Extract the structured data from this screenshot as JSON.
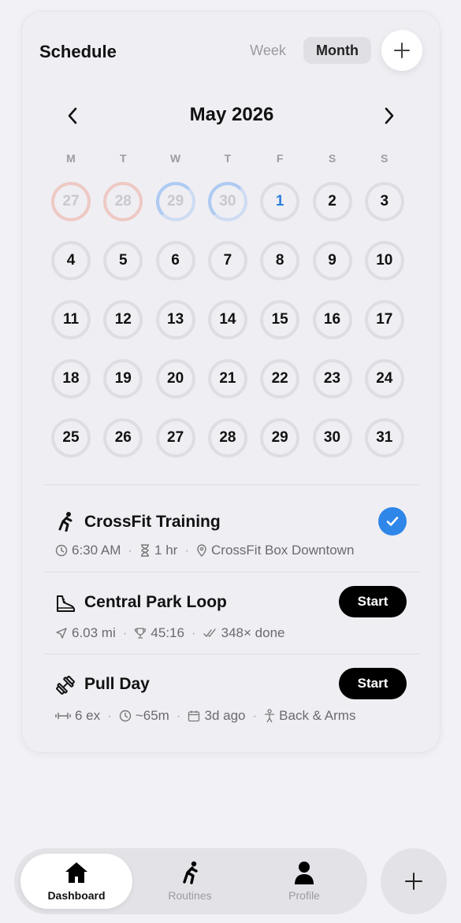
{
  "header": {
    "title": "Schedule",
    "week_label": "Week",
    "month_label": "Month"
  },
  "calendar": {
    "month_label": "May 2026",
    "weekdays": [
      "M",
      "T",
      "W",
      "T",
      "F",
      "S",
      "S"
    ],
    "days": [
      {
        "label": "27",
        "status": "missed"
      },
      {
        "label": "28",
        "status": "missed"
      },
      {
        "label": "29",
        "status": "in-progress"
      },
      {
        "label": "30",
        "status": "in-progress"
      },
      {
        "label": "1",
        "status": "today"
      },
      {
        "label": "2",
        "status": "normal"
      },
      {
        "label": "3",
        "status": "normal"
      },
      {
        "label": "4",
        "status": "normal"
      },
      {
        "label": "5",
        "status": "normal"
      },
      {
        "label": "6",
        "status": "normal"
      },
      {
        "label": "7",
        "status": "normal"
      },
      {
        "label": "8",
        "status": "normal"
      },
      {
        "label": "9",
        "status": "normal"
      },
      {
        "label": "10",
        "status": "normal"
      },
      {
        "label": "11",
        "status": "normal"
      },
      {
        "label": "12",
        "status": "normal"
      },
      {
        "label": "13",
        "status": "normal"
      },
      {
        "label": "14",
        "status": "normal"
      },
      {
        "label": "15",
        "status": "normal"
      },
      {
        "label": "16",
        "status": "normal"
      },
      {
        "label": "17",
        "status": "normal"
      },
      {
        "label": "18",
        "status": "normal"
      },
      {
        "label": "19",
        "status": "normal"
      },
      {
        "label": "20",
        "status": "normal"
      },
      {
        "label": "21",
        "status": "normal"
      },
      {
        "label": "22",
        "status": "normal"
      },
      {
        "label": "23",
        "status": "normal"
      },
      {
        "label": "24",
        "status": "normal"
      },
      {
        "label": "25",
        "status": "normal"
      },
      {
        "label": "26",
        "status": "normal"
      },
      {
        "label": "27",
        "status": "normal"
      },
      {
        "label": "28",
        "status": "normal"
      },
      {
        "label": "29",
        "status": "normal"
      },
      {
        "label": "30",
        "status": "normal"
      },
      {
        "label": "31",
        "status": "normal"
      }
    ]
  },
  "items": [
    {
      "title": "CrossFit Training",
      "icon": "stretch-figure-icon",
      "status": "completed",
      "time": "6:30 AM",
      "duration": "1 hr",
      "location": "CrossFit Box Downtown"
    },
    {
      "title": "Central Park Loop",
      "icon": "shoe-icon",
      "action": "Start",
      "distance": "6.03 mi",
      "best_time": "45:16",
      "done_count": "348× done"
    },
    {
      "title": "Pull Day",
      "icon": "dumbbell-icon",
      "action": "Start",
      "exercises": "6 ex",
      "est_time": "~65m",
      "last_done": "3d ago",
      "muscles": "Back & Arms"
    }
  ],
  "tabbar": {
    "tabs": [
      {
        "label": "Dashboard",
        "icon": "home-icon",
        "active": true
      },
      {
        "label": "Routines",
        "icon": "stretch-figure-icon",
        "active": false
      },
      {
        "label": "Profile",
        "icon": "person-icon",
        "active": false
      }
    ]
  },
  "colors": {
    "accent": "#2e86e8",
    "missed": "#eec9c3",
    "progress": "#aecbf2",
    "primary_button": "#000000"
  }
}
